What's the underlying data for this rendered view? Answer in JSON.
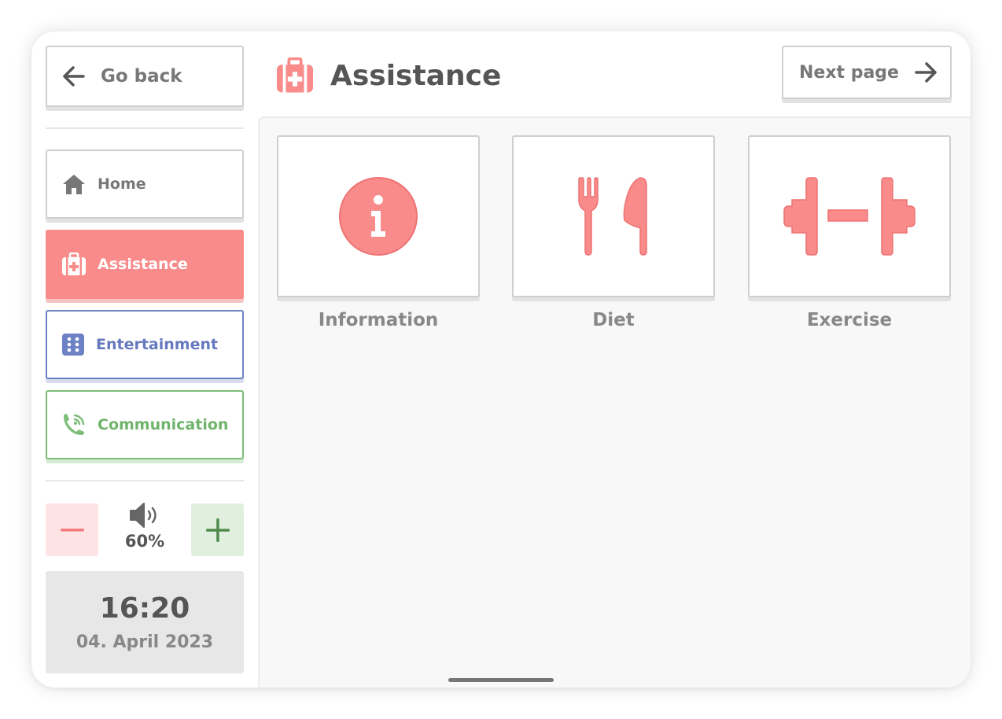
{
  "nav": {
    "back_label": "Go back",
    "next_label": "Next page",
    "items": [
      {
        "label": "Home",
        "icon": "home-icon",
        "color": "#777777"
      },
      {
        "label": "Assistance",
        "icon": "first-aid-kit-icon",
        "color": "#f98b8b",
        "active": true
      },
      {
        "label": "Entertainment",
        "icon": "dice-icon",
        "color": "#6579be"
      },
      {
        "label": "Communication",
        "icon": "phone-icon",
        "color": "#6fb46a"
      }
    ]
  },
  "header": {
    "title": "Assistance",
    "icon": "first-aid-kit-icon"
  },
  "volume": {
    "percent_label": "60%",
    "minus_icon": "minus-icon",
    "plus_icon": "plus-icon",
    "speaker_icon": "speaker-icon"
  },
  "clock": {
    "time": "16:20",
    "date": "04. April 2023"
  },
  "cards": [
    {
      "label": "Information",
      "icon": "info-icon"
    },
    {
      "label": "Diet",
      "icon": "fork-knife-icon"
    },
    {
      "label": "Exercise",
      "icon": "dumbbell-icon"
    }
  ],
  "colors": {
    "accent": "#f98b8b",
    "entertainment": "#6579be",
    "communication": "#6fb46a"
  }
}
